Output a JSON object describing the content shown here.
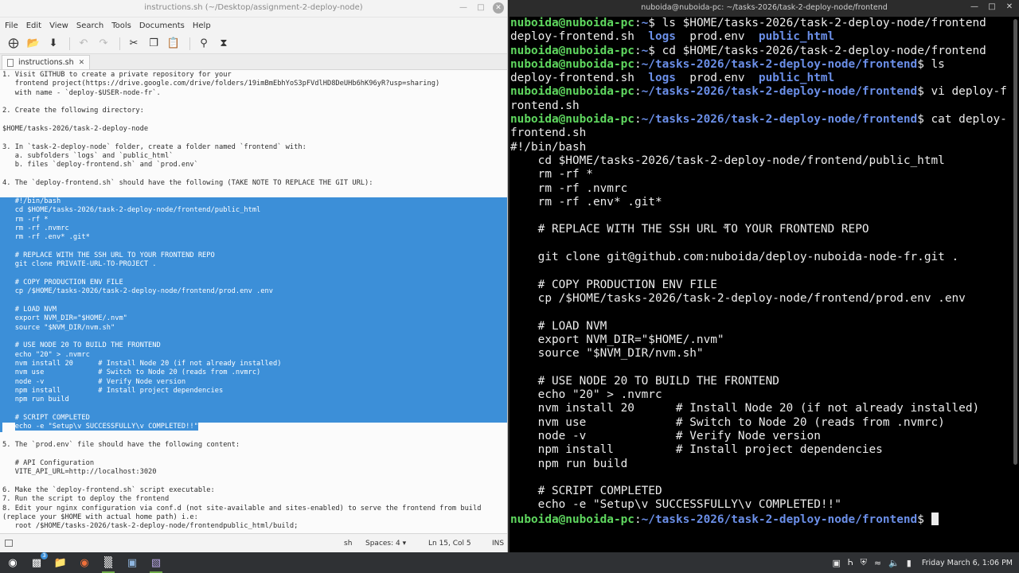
{
  "editor": {
    "title": "instructions.sh (~/Desktop/assignment-2-deploy-node)",
    "menu": [
      "File",
      "Edit",
      "View",
      "Search",
      "Tools",
      "Documents",
      "Help"
    ],
    "tab_label": "instructions.sh",
    "lines": [
      "1. Visit GITHUB to create a private repository for your",
      "   frontend project(https://drive.google.com/drive/folders/19imBmEbhYoS3pFVdlHD8DeUHb6hK96yR?usp=sharing)",
      "   with name - `deploy-$USER-node-fr`.",
      "",
      "2. Create the following directory:",
      "",
      "$HOME/tasks-2026/task-2-deploy-node",
      "",
      "3. In `task-2-deploy-node` folder, create a folder named `frontend` with:",
      "   a. subfolders `logs` and `public_html`",
      "   b. files `deploy-frontend.sh` and `prod.env`",
      "",
      "4. The `deploy-frontend.sh` should have the following (TAKE NOTE TO REPLACE THE GIT URL):",
      "",
      "   #!/bin/bash",
      "   cd $HOME/tasks-2026/task-2-deploy-node/frontend/public_html",
      "   rm -rf *",
      "   rm -rf .nvmrc",
      "   rm -rf .env* .git*",
      "",
      "   # REPLACE WITH THE SSH URL TO YOUR FRONTEND REPO",
      "   git clone PRIVATE-URL-TO-PROJECT .",
      "",
      "   # COPY PRODUCTION ENV FILE",
      "   cp /$HOME/tasks-2026/task-2-deploy-node/frontend/prod.env .env",
      "",
      "   # LOAD NVM",
      "   export NVM_DIR=\"$HOME/.nvm\"",
      "   source \"$NVM_DIR/nvm.sh\"",
      "",
      "   # USE NODE 20 TO BUILD THE FRONTEND",
      "   echo \"20\" > .nvmrc",
      "   nvm install 20      # Install Node 20 (if not already installed)",
      "   nvm use             # Switch to Node 20 (reads from .nvmrc)",
      "   node -v             # Verify Node version",
      "   npm install         # Install project dependencies",
      "   npm run build",
      "",
      "   # SCRIPT COMPLETED",
      "   echo -e \"Setup\\v SUCCESSFULLY\\v COMPLETED!!\"",
      "",
      "5. The `prod.env` file should have the following content:",
      "",
      "   # API Configuration",
      "   VITE_API_URL=http://localhost:3020",
      "",
      "6. Make the `deploy-frontend.sh` script executable:",
      "7. Run the script to deploy the frontend",
      "8. Edit your nginx configuration via conf.d (not site-available and sites-enabled) to serve the frontend from build",
      "(replace your $HOME with actual home path) i.e:",
      "   root /$HOME/tasks-2026/task-2-deploy-node/frontendpublic_html/build;"
    ],
    "status": {
      "language": "sh",
      "spaces": "Spaces: 4",
      "position": "Ln 15, Col 5",
      "mode": "INS"
    }
  },
  "terminal": {
    "title": "nuboida@nuboida-pc: ~/tasks-2026/task-2-deploy-node/frontend",
    "user": "nuboida@nuboida-pc",
    "lines": [
      {
        "type": "prompt",
        "path": "~",
        "cmd": " ls $HOME/tasks-2026/task-2-deploy-node/frontend"
      },
      {
        "type": "ls",
        "items": [
          "deploy-frontend.sh",
          "logs",
          "prod.env",
          "public_html"
        ]
      },
      {
        "type": "prompt",
        "path": "~",
        "cmd": " cd $HOME/tasks-2026/task-2-deploy-node/frontend"
      },
      {
        "type": "prompt",
        "path": "~/tasks-2026/task-2-deploy-node/frontend",
        "cmd": " ls"
      },
      {
        "type": "ls",
        "items": [
          "deploy-frontend.sh",
          "logs",
          "prod.env",
          "public_html"
        ]
      },
      {
        "type": "prompt",
        "path": "~/tasks-2026/task-2-deploy-node/frontend",
        "cmd": " vi deploy-f"
      },
      {
        "type": "text",
        "text": "rontend.sh"
      },
      {
        "type": "prompt",
        "path": "~/tasks-2026/task-2-deploy-node/frontend",
        "cmd": " cat deploy-"
      },
      {
        "type": "text",
        "text": "frontend.sh"
      },
      {
        "type": "text",
        "text": "#!/bin/bash"
      },
      {
        "type": "text",
        "text": "    cd $HOME/tasks-2026/task-2-deploy-node/frontend/public_html"
      },
      {
        "type": "text",
        "text": "    rm -rf *"
      },
      {
        "type": "text",
        "text": "    rm -rf .nvmrc"
      },
      {
        "type": "text",
        "text": "    rm -rf .env* .git*"
      },
      {
        "type": "text",
        "text": ""
      },
      {
        "type": "text",
        "text": "    # REPLACE WITH THE SSH URL TO YOUR FRONTEND REPO"
      },
      {
        "type": "text",
        "text": ""
      },
      {
        "type": "text",
        "text": "    git clone git@github.com:nuboida/deploy-nuboida-node-fr.git ."
      },
      {
        "type": "text",
        "text": ""
      },
      {
        "type": "text",
        "text": "    # COPY PRODUCTION ENV FILE"
      },
      {
        "type": "text",
        "text": "    cp /$HOME/tasks-2026/task-2-deploy-node/frontend/prod.env .env"
      },
      {
        "type": "text",
        "text": ""
      },
      {
        "type": "text",
        "text": "    # LOAD NVM"
      },
      {
        "type": "text",
        "text": "    export NVM_DIR=\"$HOME/.nvm\""
      },
      {
        "type": "text",
        "text": "    source \"$NVM_DIR/nvm.sh\""
      },
      {
        "type": "text",
        "text": ""
      },
      {
        "type": "text",
        "text": "    # USE NODE 20 TO BUILD THE FRONTEND"
      },
      {
        "type": "text",
        "text": "    echo \"20\" > .nvmrc"
      },
      {
        "type": "text",
        "text": "    nvm install 20      # Install Node 20 (if not already installed)"
      },
      {
        "type": "text",
        "text": "    nvm use             # Switch to Node 20 (reads from .nvmrc)"
      },
      {
        "type": "text",
        "text": "    node -v             # Verify Node version"
      },
      {
        "type": "text",
        "text": "    npm install         # Install project dependencies"
      },
      {
        "type": "text",
        "text": "    npm run build"
      },
      {
        "type": "text",
        "text": ""
      },
      {
        "type": "text",
        "text": "    # SCRIPT COMPLETED"
      },
      {
        "type": "text",
        "text": "    echo -e \"Setup\\v SUCCESSFULLY\\v COMPLETED!!\""
      },
      {
        "type": "prompt",
        "path": "~/tasks-2026/task-2-deploy-node/frontend",
        "cmd": " ",
        "cursor": true
      }
    ]
  },
  "taskbar": {
    "badge": "3",
    "clock": "Friday March 6, 1:06 PM"
  }
}
